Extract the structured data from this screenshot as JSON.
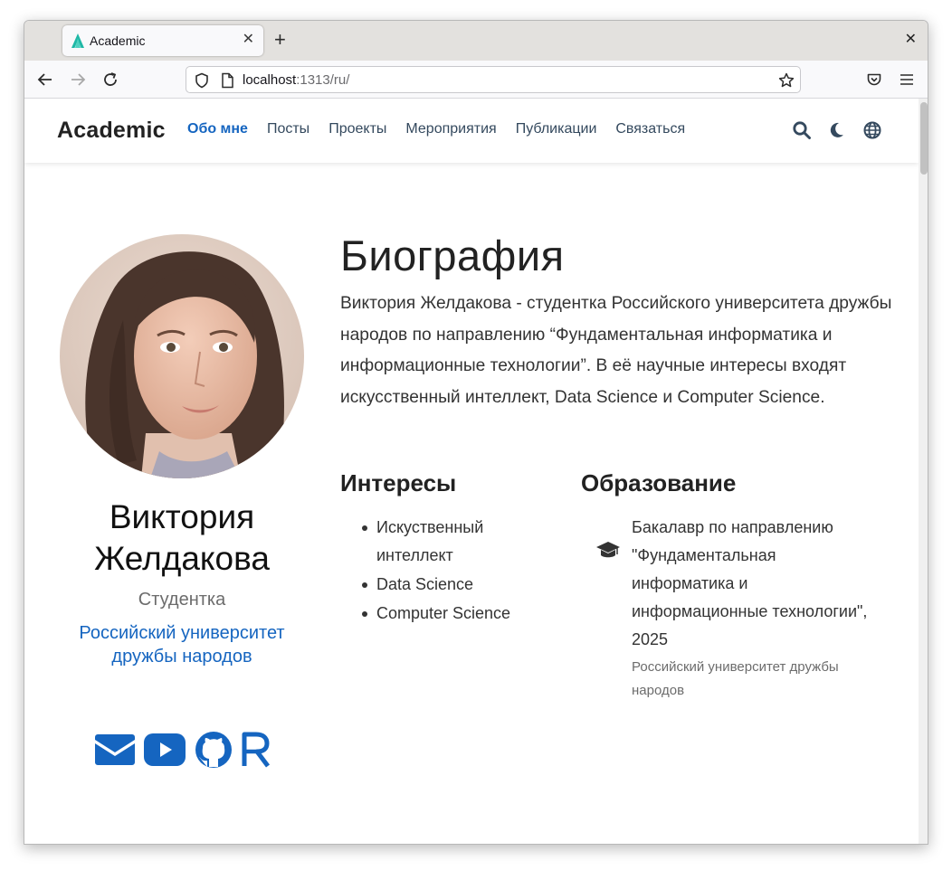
{
  "browser": {
    "tab_title": "Academic",
    "url_host": "localhost",
    "url_rest": ":1313/ru/"
  },
  "site": {
    "brand": "Academic",
    "menu": [
      {
        "label": "Обо мне",
        "active": true
      },
      {
        "label": "Посты",
        "active": false
      },
      {
        "label": "Проекты",
        "active": false
      },
      {
        "label": "Мероприятия",
        "active": false
      },
      {
        "label": "Публикации",
        "active": false
      },
      {
        "label": "Связаться",
        "active": false
      }
    ],
    "accent_color": "#1565c0"
  },
  "profile": {
    "name": "Виктория Желдакова",
    "role": "Студентка",
    "organization": "Российский университет дружбы народов",
    "social_icons": [
      "envelope-icon",
      "youtube-icon",
      "github-icon",
      "r-icon"
    ]
  },
  "biography": {
    "title": "Биография",
    "text": "Виктория Желдакова - студентка Российского университета дружбы народов по направлению “Фундаментальная информатика и информационные технологии”. В её научные интересы входят искусственный интеллект, Data Science и Computer Science."
  },
  "interests": {
    "title": "Интересы",
    "items": [
      "Искуственный интеллект",
      "Data Science",
      "Computer Science"
    ]
  },
  "education": {
    "title": "Образование",
    "course": "Бакалавр по направлению \"Фундаментальная информатика и информационные технологии\", 2025",
    "institution": "Российский университет дружбы народов"
  }
}
